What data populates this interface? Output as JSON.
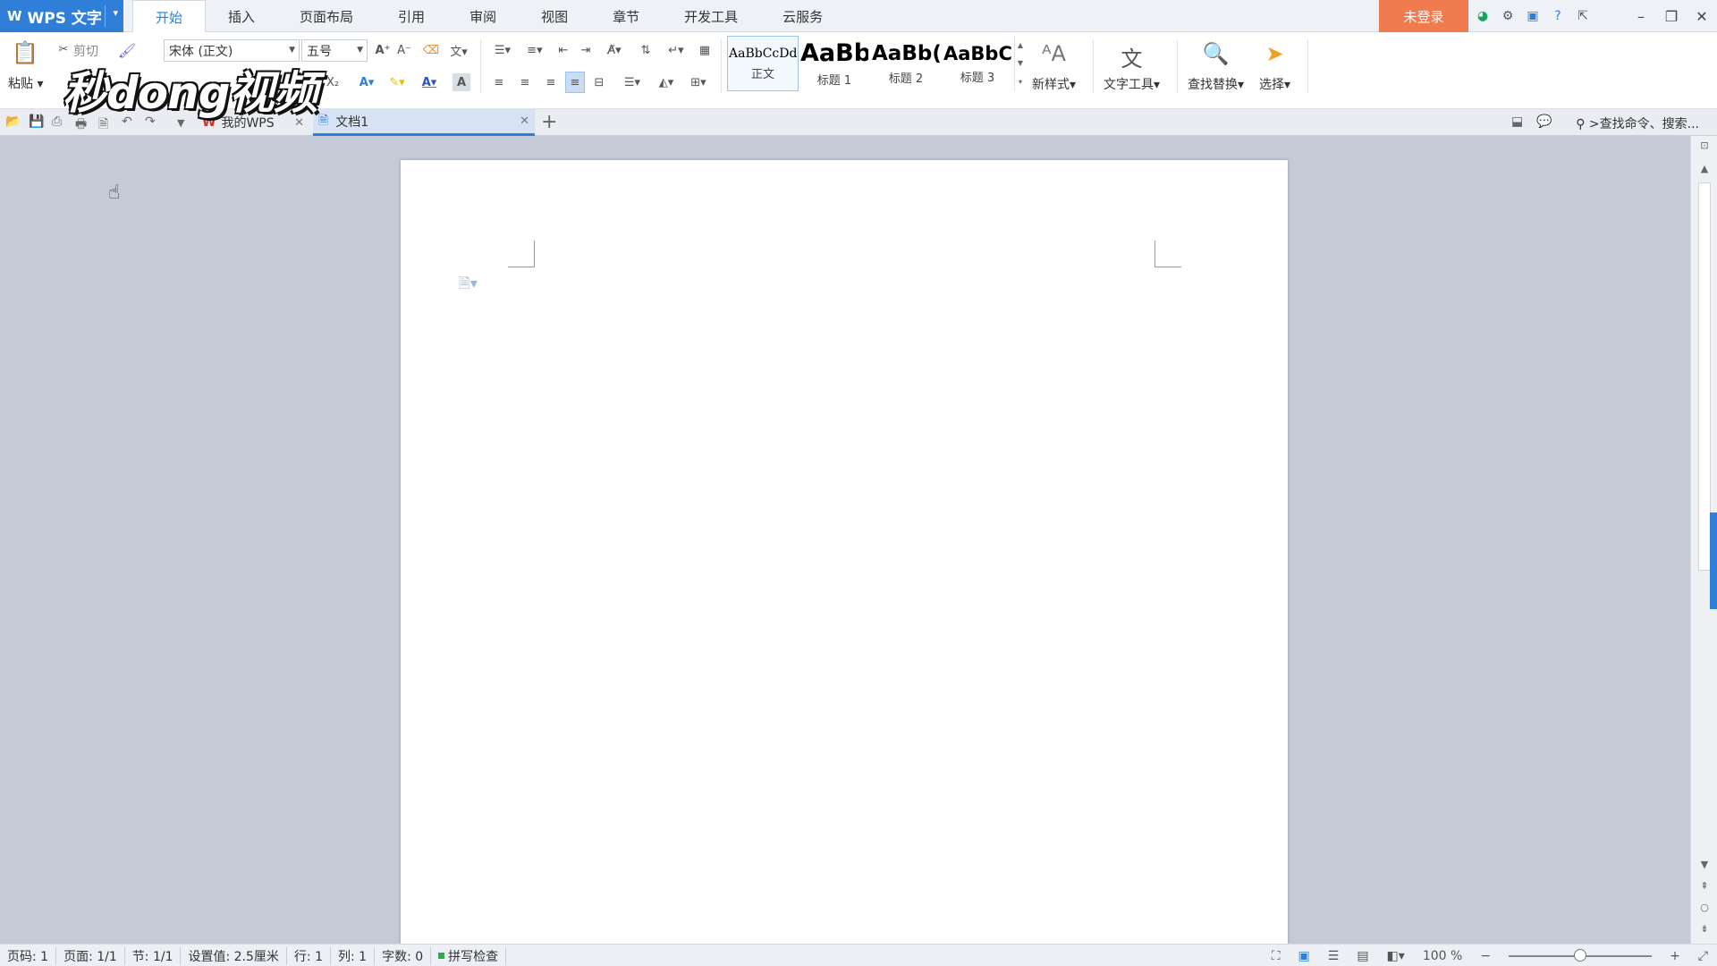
{
  "app": {
    "name": "WPS 文字",
    "logo": "W"
  },
  "menu": [
    {
      "label": "开始",
      "active": true
    },
    {
      "label": "插入"
    },
    {
      "label": "页面布局"
    },
    {
      "label": "引用"
    },
    {
      "label": "审阅"
    },
    {
      "label": "视图"
    },
    {
      "label": "章节"
    },
    {
      "label": "开发工具"
    },
    {
      "label": "云服务"
    }
  ],
  "login_label": "未登录",
  "ribbon": {
    "paste_label": "粘贴",
    "cut_label": "剪切",
    "font_name": "宋体 (正文)",
    "font_size": "五号",
    "styles": [
      {
        "sample": "AaBbCcDd",
        "name": "正文"
      },
      {
        "sample": "AaBb",
        "name": "标题 1"
      },
      {
        "sample": "AaBb(",
        "name": "标题 2"
      },
      {
        "sample": "AaBbC",
        "name": "标题 3"
      }
    ],
    "new_style_label": "新样式",
    "text_tools_label": "文字工具",
    "find_replace_label": "查找替换",
    "select_label": "选择"
  },
  "tabs": [
    {
      "label": "我的WPS"
    },
    {
      "label": "文档1",
      "active": true
    }
  ],
  "search_cmd": ">查找命令、搜索...",
  "watermark": "秒dong视频",
  "status": {
    "page_num": "页码: 1",
    "pages": "页面: 1/1",
    "section": "节: 1/1",
    "setting": "设置值: 2.5厘米",
    "row": "行: 1",
    "col": "列: 1",
    "word_count": "字数: 0",
    "spell_check": "拼写检查",
    "zoom": "100 %",
    "zoom_level": 0.5
  },
  "colors": {
    "accent": "#2f7fd8",
    "login": "#ef7b4e"
  }
}
